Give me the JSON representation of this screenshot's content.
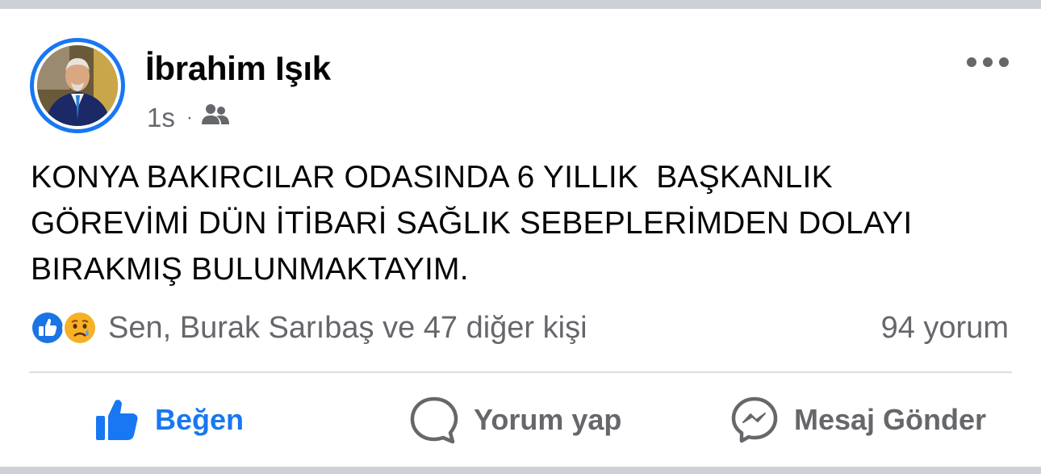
{
  "post": {
    "author": "İbrahim Işık",
    "time": "1s",
    "separator": "·",
    "audience_icon": "friends-icon",
    "more_icon": "more-horizontal-icon",
    "text": "KONYA BAKIRCILAR ODASINDA 6 YILLIK  BAŞKANLIK\nGÖREVİMİ DÜN İTİBARİ SAĞLIK SEBEPLERİMDEN DOLAYI\nBIRAKMIŞ BULUNMAKTAYIM."
  },
  "reactions": {
    "icons": [
      "like-reaction-icon",
      "sad-reaction-icon"
    ],
    "names": "Sen, Burak Sarıbaş ve 47 diğer kişi",
    "comments": "94 yorum"
  },
  "actions": {
    "like": "Beğen",
    "comment": "Yorum yap",
    "message": "Mesaj Gönder"
  },
  "colors": {
    "accent": "#1877f2",
    "secondary_text": "#65676b",
    "primary_text": "#050505",
    "divider": "#dadde1"
  }
}
